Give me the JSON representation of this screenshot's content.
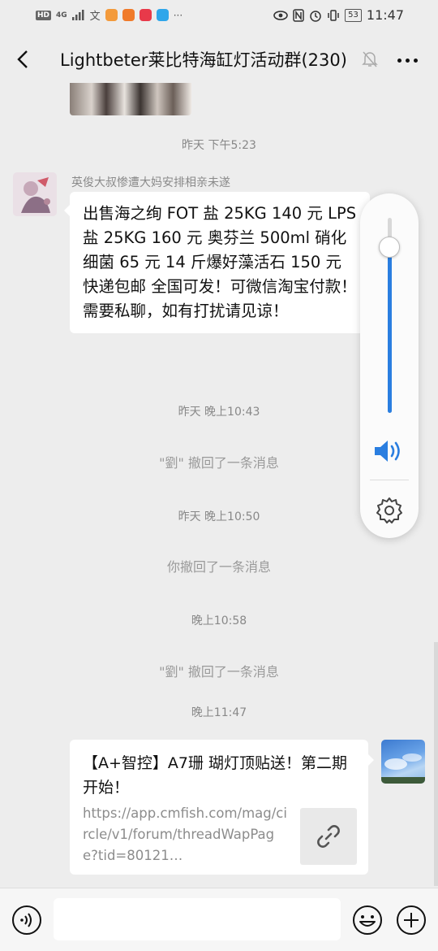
{
  "status_bar": {
    "network_hd": "HD",
    "network_gen": "4G",
    "time": "11:47",
    "battery": "53",
    "more": "···"
  },
  "header": {
    "title": "Lightbeter莱比特海缸灯活动群(230)"
  },
  "messages": {
    "ts1": "昨天 下午5:23",
    "sender1": "英俊大叔惨遭大妈安排相亲未遂",
    "text1": "出售海之绚 FOT 盐 25KG 140 元 LPS 盐 25KG 160 元  奥芬兰 500ml 硝化细菌 65 元  14 斤爆好藻活石 150 元 快递包邮 全国可发！可微信淘宝付款！需要私聊，如有打扰请见谅！",
    "ts2": "昨天 晚上10:43",
    "sys1": "\"劉\" 撤回了一条消息",
    "ts3": "昨天 晚上10:50",
    "sys2": "你撤回了一条消息",
    "ts4": "晚上10:58",
    "sys3": "\"劉\" 撤回了一条消息",
    "ts5": "晚上11:47",
    "link_title": "【A+智控】A7珊 瑚灯顶贴送！第二期开始！",
    "link_url": "https://app.cmfish.com/mag/circle/v1/forum/threadWapPage?tid=80121…"
  },
  "volume_panel": {
    "level": 0.85
  },
  "icons": {
    "back": "back-arrow-icon",
    "mute": "bell-muted-icon",
    "more": "more-dots-icon",
    "speaker": "speaker-icon",
    "settings": "gear-icon",
    "voice": "voice-input-icon",
    "emoji": "emoji-icon",
    "plus": "plus-icon",
    "link": "link-icon"
  },
  "colors": {
    "accent": "#2a7ee0",
    "background": "#ededed",
    "bubble": "#ffffff"
  }
}
